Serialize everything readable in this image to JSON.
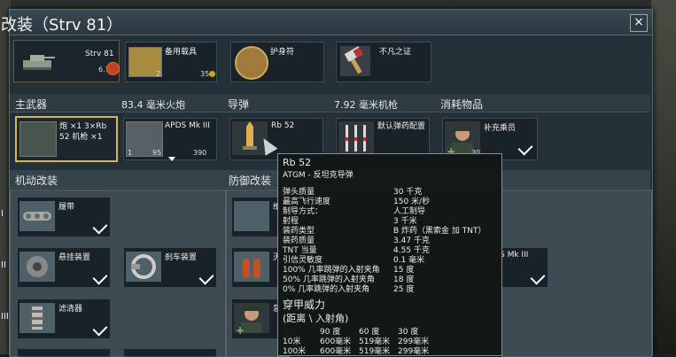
{
  "window": {
    "title": "改装（Strv 81）",
    "close_glyph": "×"
  },
  "top_row": {
    "vehicle": {
      "name": "Strv 81",
      "value": "6.7"
    },
    "items": [
      {
        "label": "备用载具",
        "count1": "2",
        "count2": "35"
      },
      {
        "label": "护身符"
      },
      {
        "label": "不凡之证"
      }
    ]
  },
  "weapons_header": [
    "主武器",
    "83.4 毫米火炮",
    "导弹",
    "7.92 毫米机枪",
    "消耗物品"
  ],
  "weapons": {
    "main_text": "炮 ×1 3×Rb 52 机枪 ×1",
    "apds_label": "APDS Mk III",
    "apds_left": "1",
    "apds_mid": "95",
    "apds_count": "390",
    "rb_label": "Rb 52",
    "mg_label": "默认弹药配置",
    "crew_label": "补充乘员",
    "crew_count": "30"
  },
  "section_mobility": "机动改装",
  "section_defense": "防御改装",
  "mobility": [
    {
      "label": "履带"
    },
    {
      "label": "悬挂装置"
    },
    {
      "label": "刹车装置"
    },
    {
      "label": "滤清器"
    }
  ],
  "defense_partial": [
    "维",
    "灭",
    "急"
  ],
  "right_partial": "S Mk III",
  "side_nums": [
    "I",
    "II",
    "III"
  ],
  "tooltip": {
    "title": "Rb 52",
    "subtitle": "ATGM - 反坦克导弹",
    "rows": [
      [
        "弹头质量",
        "30 千克"
      ],
      [
        "最高飞行速度",
        "150 米/秒"
      ],
      [
        "制导方式：",
        "人工制导"
      ],
      [
        "射程",
        "3 千米"
      ],
      [
        "装药类型",
        "B 炸药（黑索金 加 TNT）"
      ],
      [
        "装药质量",
        "3.47 千克"
      ],
      [
        "TNT 当量",
        "4.55 千克"
      ],
      [
        "引信灵敏度",
        "0.1 毫米"
      ],
      [
        "100% 几率跳弹的入射夹角",
        "15 度"
      ],
      [
        "50% 几率跳弹的入射夹角",
        "18 度"
      ],
      [
        "0% 几率跳弹的入射夹角",
        "25 度"
      ]
    ],
    "pen_title": "穿甲威力",
    "pen_sub": "(距离 \\ 入射角)",
    "angles": [
      "90 度",
      "60 度",
      "30 度"
    ],
    "pen_rows": [
      [
        "10米",
        "600毫米",
        "519毫米",
        "299毫米"
      ],
      [
        "100米",
        "600毫米",
        "519毫米",
        "299毫米"
      ]
    ]
  }
}
